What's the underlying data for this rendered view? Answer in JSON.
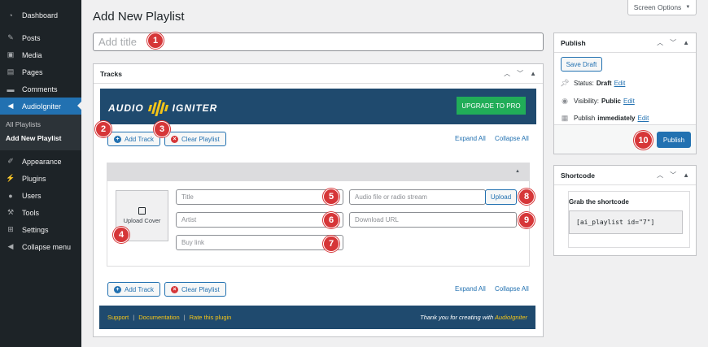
{
  "sidebar": {
    "items": [
      {
        "label": "Dashboard",
        "icon": "dashboard-icon"
      },
      {
        "label": "Posts",
        "icon": "pin-icon"
      },
      {
        "label": "Media",
        "icon": "media-icon"
      },
      {
        "label": "Pages",
        "icon": "page-icon"
      },
      {
        "label": "Comments",
        "icon": "comment-icon"
      },
      {
        "label": "AudioIgniter",
        "icon": "speaker-icon",
        "active": true
      },
      {
        "label": "Appearance",
        "icon": "brush-icon"
      },
      {
        "label": "Plugins",
        "icon": "plug-icon"
      },
      {
        "label": "Users",
        "icon": "user-icon"
      },
      {
        "label": "Tools",
        "icon": "wrench-icon"
      },
      {
        "label": "Settings",
        "icon": "settings-icon"
      },
      {
        "label": "Collapse menu",
        "icon": "collapse-icon"
      }
    ],
    "submenu": [
      {
        "label": "All Playlists"
      },
      {
        "label": "Add New Playlist",
        "current": true
      }
    ]
  },
  "header": {
    "screen_options": "Screen Options",
    "page_title": "Add New Playlist",
    "title_placeholder": "Add title"
  },
  "tracks": {
    "box_title": "Tracks",
    "brand_left": "AUDIO",
    "brand_right": "IGNITER",
    "upgrade_label": "UPGRADE TO PRO",
    "add_track": "Add Track",
    "clear_playlist": "Clear Playlist",
    "expand_all": "Expand All",
    "collapse_all": "Collapse All",
    "upload_cover": "Upload Cover",
    "title_placeholder": "Title",
    "artist_placeholder": "Artist",
    "buy_link_placeholder": "Buy link",
    "audio_placeholder": "Audio file or radio stream",
    "upload_label": "Upload",
    "download_placeholder": "Download URL",
    "footer_support": "Support",
    "footer_docs": "Documentation",
    "footer_rate": "Rate this plugin",
    "footer_sep": "|",
    "footer_thanks": "Thank you for creating with",
    "footer_brand": "AudioIgniter"
  },
  "publish": {
    "title": "Publish",
    "save_draft": "Save Draft",
    "status_label": "Status:",
    "status_value": "Draft",
    "visibility_label": "Visibility:",
    "visibility_value": "Public",
    "publish_label": "Publish",
    "publish_value": "immediately",
    "edit": "Edit",
    "publish_button": "Publish"
  },
  "shortcode": {
    "title": "Shortcode",
    "label": "Grab the shortcode",
    "code": "[ai_playlist id=\"7\"]"
  },
  "callouts": [
    "1",
    "2",
    "3",
    "4",
    "5",
    "6",
    "7",
    "8",
    "9",
    "10"
  ],
  "colors": {
    "accent": "#2271b1",
    "sidebar_bg": "#1d2327",
    "brand_bg": "#1f4a6e",
    "upgrade_green": "#21ad58",
    "brand_yellow": "#f5c518",
    "callout_red": "#d63638"
  }
}
